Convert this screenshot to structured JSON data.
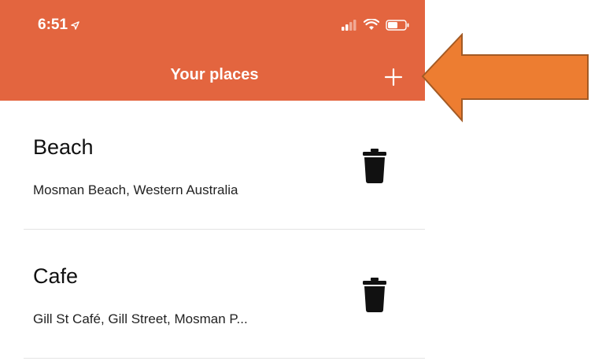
{
  "status_bar": {
    "time": "6:51"
  },
  "nav": {
    "title": "Your places",
    "add_label": "+"
  },
  "places": [
    {
      "title": "Beach",
      "address": "Mosman Beach, Western Australia"
    },
    {
      "title": "Cafe",
      "address": "Gill St Café, Gill Street, Mosman P..."
    }
  ],
  "colors": {
    "header": "#e3653f",
    "callout_arrow": "#ed7d31",
    "callout_arrow_border": "#a35a24"
  },
  "icons": {
    "location": "location-arrow-icon",
    "signal": "signal-icon",
    "wifi": "wifi-icon",
    "battery": "battery-icon",
    "add": "plus-icon",
    "delete": "trash-icon"
  }
}
